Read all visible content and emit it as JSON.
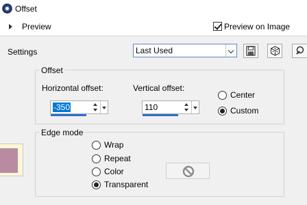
{
  "window": {
    "title": "Offset"
  },
  "preview": {
    "label": "Preview",
    "preview_on_image_label": "Preview on Image",
    "preview_on_image_checked": true
  },
  "settings": {
    "label": "Settings",
    "preset": "Last Used"
  },
  "offset": {
    "group_title": "Offset",
    "horizontal_label": "Horizontal offset:",
    "horizontal_value": "-350",
    "vertical_label": "Vertical offset:",
    "vertical_value": "110",
    "center_label": "Center",
    "custom_label": "Custom",
    "selected": "Custom"
  },
  "edge_mode": {
    "group_title": "Edge mode",
    "options": [
      "Wrap",
      "Repeat",
      "Color",
      "Transparent"
    ],
    "selected": "Transparent"
  },
  "colors": {
    "accent": "#0078d7",
    "thumbnail_fill": "#b88ba1",
    "thumbnail_border": "#fdf6d8"
  }
}
